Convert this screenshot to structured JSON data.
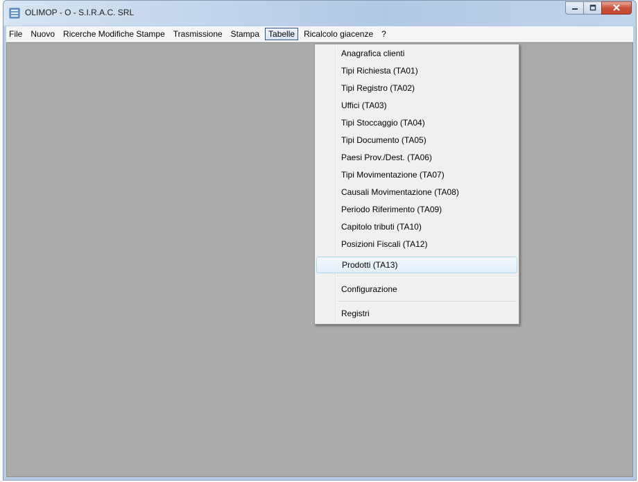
{
  "window": {
    "title": "OLIMOP - O - S.I.R.A.C. SRL",
    "app_icon": "database-icon",
    "caption_icons": [
      "minimize-icon",
      "maximize-icon",
      "close-icon"
    ]
  },
  "menubar": {
    "items": [
      {
        "label": "File"
      },
      {
        "label": "Nuovo"
      },
      {
        "label": "Ricerche Modifiche Stampe"
      },
      {
        "label": "Trasmissione"
      },
      {
        "label": "Stampa"
      },
      {
        "label": "Tabelle"
      },
      {
        "label": "Ricalcolo giacenze"
      },
      {
        "label": "?"
      }
    ],
    "active": "Tabelle"
  },
  "dropdown": {
    "items": [
      {
        "label": "Anagrafica clienti"
      },
      {
        "label": "Tipi Richiesta (TA01)"
      },
      {
        "label": "Tipi Registro (TA02)"
      },
      {
        "label": "Uffici (TA03)"
      },
      {
        "label": "Tipi Stoccaggio (TA04)"
      },
      {
        "label": "Tipi Documento (TA05)"
      },
      {
        "label": "Paesi Prov./Dest. (TA06)"
      },
      {
        "label": "Tipi Movimentazione (TA07)"
      },
      {
        "label": "Causali Movimentazione (TA08)"
      },
      {
        "label": "Periodo Riferimento (TA09)"
      },
      {
        "label": "Capitolo tributi (TA10)"
      },
      {
        "label": "Posizioni Fiscali (TA12)"
      },
      {
        "label": "Prodotti (TA13)"
      },
      {
        "label": "Configurazione"
      },
      {
        "label": "Registri"
      }
    ],
    "highlighted": "Prodotti (TA13)"
  },
  "colors": {
    "client_background": "#ababab",
    "menu_highlight_border": "#a8d8eb",
    "active_menu_border": "#2f4f7f"
  }
}
